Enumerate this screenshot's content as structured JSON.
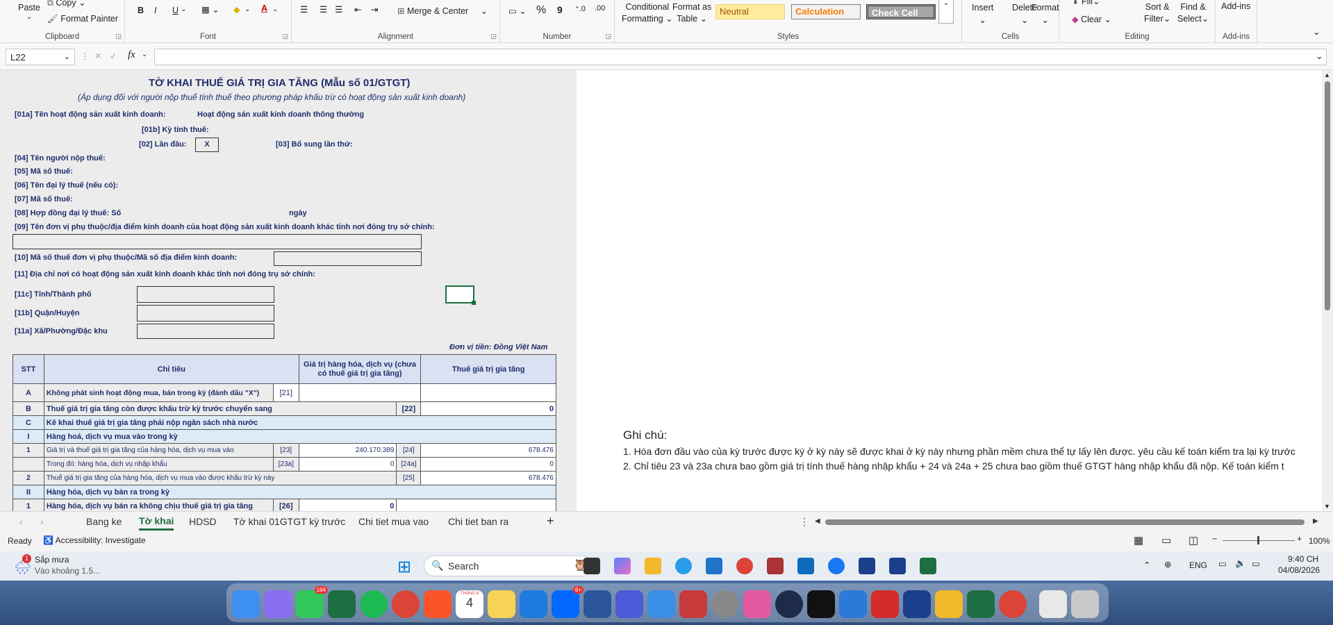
{
  "ribbon": {
    "clipboard": {
      "paste": "Paste",
      "copy": "Copy",
      "format_painter": "Format Painter",
      "group": "Clipboard"
    },
    "font": {
      "group": "Font",
      "bold": "B",
      "italic": "I",
      "underline": "U"
    },
    "alignment": {
      "group": "Alignment",
      "merge": "Merge & Center"
    },
    "number": {
      "group": "Number",
      "percent": "%",
      "comma": "9"
    },
    "styles": {
      "group": "Styles",
      "cond_fmt": "Conditional Formatting",
      "cond_fmt_1": "Conditional",
      "cond_fmt_2": "Formatting",
      "fmt_table_1": "Format as",
      "fmt_table_2": "Table",
      "neutral": "Neutral",
      "calculation": "Calculation",
      "check_cell": "Check Cell"
    },
    "cells": {
      "group": "Cells",
      "insert": "Insert",
      "delete": "Delete",
      "format": "Format"
    },
    "editing": {
      "group": "Editing",
      "fill": "Fill",
      "clear": "Clear",
      "sort_1": "Sort &",
      "sort_2": "Filter",
      "find_1": "Find &",
      "find_2": "Select"
    },
    "addins": {
      "group": "Add-ins",
      "label": "Add-ins"
    }
  },
  "formula_bar": {
    "name_box": "L22",
    "fx": "fx",
    "value": ""
  },
  "form": {
    "title": "TỜ KHAI THUẾ GIÁ TRỊ GIA TĂNG (Mẫu số 01/GTGT)",
    "subtitle": "(Áp dụng đối với người nộp thuế tính thuế theo phương pháp khấu trừ có hoạt động sản xuất kinh doanh)",
    "l01a": "[01a] Tên hoạt động sản xuất kinh doanh:",
    "l01a_val": "Hoạt động sản xuất kinh doanh thông thường",
    "l01b": "[01b] Kỳ tính thuế:",
    "l02": "[02] Lần đầu:",
    "l02_val": "X",
    "l03": "[03] Bổ sung lần thứ:",
    "l04": "[04] Tên người nộp thuế:",
    "l05": "[05] Mã số thuế:",
    "l06": "[06] Tên đại lý thuế (nếu có):",
    "l07": "[07] Mã số thuế:",
    "l08": "[08] Hợp đồng đại lý thuế: Số",
    "l08_day": "ngày",
    "l09": "[09] Tên đơn vị phụ thuộc/địa điểm kinh doanh của hoạt động sản xuất kinh doanh khác tỉnh nơi đóng trụ sở chính:",
    "l10": "[10] Mã số thuế đơn vị phụ thuộc/Mã số địa điểm kinh doanh:",
    "l11": "[11] Địa chỉ nơi có hoạt động sản xuất kinh doanh khác tỉnh nơi đóng trụ sở chính:",
    "l11c": "[11c] Tỉnh/Thành phố",
    "l11b": "[11b] Quận/Huyện",
    "l11a": "[11a] Xã/Phường/Đặc khu",
    "currency": "Đơn vị tiền: Đồng Việt Nam"
  },
  "table": {
    "headers": [
      "STT",
      "Chỉ tiêu",
      "Giá trị hàng hóa, dịch vụ (chưa có thuế giá trị gia tăng)",
      "Thuế giá trị gia tăng"
    ],
    "rows": [
      {
        "stt": "A",
        "label": "Không phát sinh hoạt động mua, bán trong kỳ (đánh dấu \"X\")",
        "code": "[21]"
      },
      {
        "stt": "B",
        "label": "Thuế giá trị gia tăng còn được khấu trừ kỳ trước chuyển sang",
        "code2": "[22]",
        "tax": "0"
      },
      {
        "stt": "C",
        "label": "Kê khai thuế giá trị gia tăng phải nộp ngân sách nhà nước"
      },
      {
        "stt": "I",
        "label": "Hàng hoá, dịch vụ mua vào trong kỳ"
      },
      {
        "stt": "1",
        "label": "Giá trị và thuế giá trị gia tăng của hàng hóa, dịch vụ mua vào",
        "code": "[23]",
        "value": "240.170.389",
        "code2": "[24]",
        "tax": "678.476"
      },
      {
        "stt": "",
        "label": "Trong đó: hàng hóa, dịch vụ nhập khẩu",
        "code": "[23a]",
        "value": "0",
        "code2": "[24a]",
        "tax": "0"
      },
      {
        "stt": "2",
        "label": "Thuế giá trị gia tăng của hàng hóa, dịch vụ mua vào được khấu trừ kỳ này",
        "code2": "[25]",
        "tax": "678.476"
      },
      {
        "stt": "II",
        "label": "Hàng hóa, dịch vụ bán ra trong kỳ"
      },
      {
        "stt": "1",
        "label": "Hàng hóa, dịch vụ bán ra không chịu thuế giá trị gia tăng",
        "code": "[26]",
        "value": "0"
      }
    ]
  },
  "notes": {
    "title": "Ghi chú:",
    "n1": "1. Hóa đơn đầu vào của kỳ trước được ký ở kỳ này sẽ được khai ở kỳ này nhưng phần mềm chưa thể tự lấy lên được. yêu cầu kế toán kiểm tra lại kỳ trước",
    "n2": "2. Chỉ tiêu 23 và 23a chưa bao gồm giá trị tính thuế hàng nhập khẩu + 24 và 24a + 25 chưa bao giồm thuế GTGT hàng nhập khẩu đã nộp. Kế toán kiểm t"
  },
  "tabs": [
    "Bang ke",
    "Tờ khai",
    "HDSD",
    "Tờ khai 01GTGT kỳ trước",
    "Chi tiet mua vao",
    "Chi tiet ban ra"
  ],
  "active_tab": "Tờ khai",
  "status": {
    "ready": "Ready",
    "accessibility": "Accessibility: Investigate",
    "zoom": "100%"
  },
  "taskbar": {
    "weather_title": "Sắp mưa",
    "weather_sub": "Vào khoảng 1.5...",
    "weather_badge": "1",
    "search": "Search",
    "lang": "ENG",
    "time": "9:40 CH",
    "date": "04/08/2026"
  },
  "dock": {
    "messages_badge": "164",
    "zalo_badge": "6+",
    "calendar_month": "THÁNG 8",
    "calendar_day": "4"
  },
  "colors": {
    "form_text": "#1f2d6b",
    "excel_green": "#1d6f42",
    "neutral_bg": "#ffeb9c",
    "calc_bg": "#f2f2f2",
    "check_bg": "#a5a5a5"
  }
}
